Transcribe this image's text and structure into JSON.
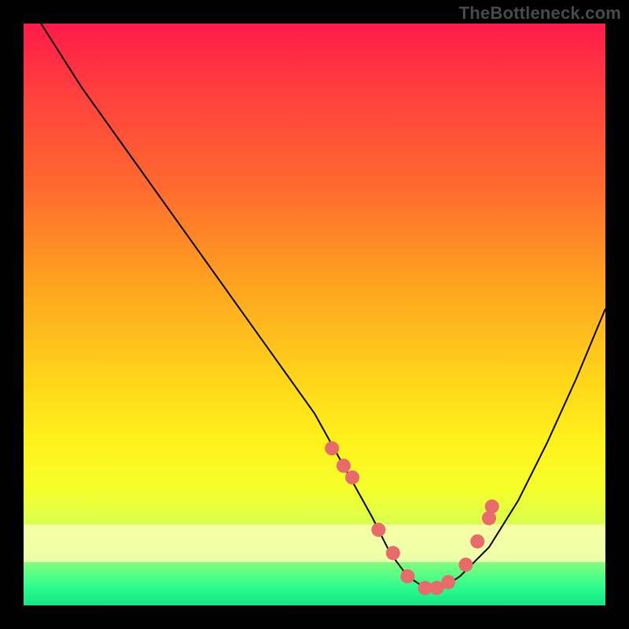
{
  "watermark": "TheBottleneck.com",
  "colors": {
    "gradient_top": "#ff1a4a",
    "gradient_bottom": "#12e684",
    "curve": "#000000",
    "marker": "#e86a6a",
    "pale_band": "#fbffb2",
    "frame": "#000000"
  },
  "chart_data": {
    "type": "line",
    "title": "",
    "xlabel": "",
    "ylabel": "",
    "xlim": [
      0,
      100
    ],
    "ylim": [
      0,
      100
    ],
    "grid": false,
    "legend_position": "none",
    "series": [
      {
        "name": "curve",
        "x": [
          3,
          10,
          20,
          30,
          40,
          50,
          55,
          60,
          63,
          66,
          69,
          72,
          75,
          80,
          85,
          90,
          95,
          100
        ],
        "y": [
          100,
          89,
          75,
          61,
          47,
          33,
          24,
          15,
          9,
          5,
          3,
          3,
          5,
          10,
          18,
          28,
          39,
          51
        ]
      }
    ],
    "markers": {
      "name": "highlighted-points",
      "x": [
        53,
        55,
        56.5,
        61,
        63.5,
        66,
        69,
        71,
        73,
        76,
        78,
        80,
        80.5
      ],
      "y": [
        27,
        24,
        22,
        13,
        9,
        5,
        3,
        3,
        4,
        7,
        11,
        15,
        17
      ]
    }
  }
}
